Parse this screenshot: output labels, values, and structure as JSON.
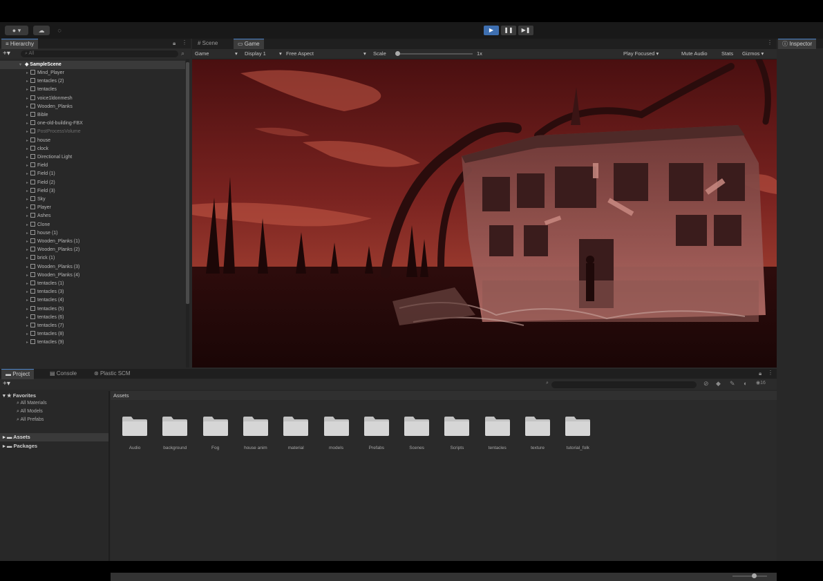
{
  "toolbar": {
    "account_label": "▾",
    "cloud_icon": "cloud-icon",
    "play_controls": [
      "▶",
      "❚❚",
      "▶❚"
    ]
  },
  "hierarchy": {
    "tab_label": "Hierarchy",
    "add_label": "+▾",
    "search_placeholder": "All",
    "root": "SampleScene",
    "items": [
      {
        "label": "Mind_Player",
        "disabled": false
      },
      {
        "label": "tentacles (2)",
        "disabled": false
      },
      {
        "label": "tentacles",
        "disabled": false
      },
      {
        "label": "voice1ldonmesh",
        "disabled": false
      },
      {
        "label": "Wooden_Planks",
        "disabled": false
      },
      {
        "label": "Bible",
        "disabled": false
      },
      {
        "label": "one-old-building-FBX",
        "disabled": false
      },
      {
        "label": "PostProcessVolume",
        "disabled": true
      },
      {
        "label": "house",
        "disabled": false
      },
      {
        "label": "clock",
        "disabled": false
      },
      {
        "label": "Directional Light",
        "disabled": false
      },
      {
        "label": "Field",
        "disabled": false
      },
      {
        "label": "Field (1)",
        "disabled": false
      },
      {
        "label": "Field (2)",
        "disabled": false
      },
      {
        "label": "Field (3)",
        "disabled": false
      },
      {
        "label": "Sky",
        "disabled": false
      },
      {
        "label": "Player",
        "disabled": false
      },
      {
        "label": "Ashes",
        "disabled": false
      },
      {
        "label": "Clone",
        "disabled": false
      },
      {
        "label": "house (1)",
        "disabled": false
      },
      {
        "label": "Wooden_Planks (1)",
        "disabled": false
      },
      {
        "label": "Wooden_Planks (2)",
        "disabled": false
      },
      {
        "label": "brick (1)",
        "disabled": false
      },
      {
        "label": "Wooden_Planks (3)",
        "disabled": false
      },
      {
        "label": "Wooden_Planks (4)",
        "disabled": false
      },
      {
        "label": "tentacles (1)",
        "disabled": false
      },
      {
        "label": "tentacles (3)",
        "disabled": false
      },
      {
        "label": "tentacles (4)",
        "disabled": false
      },
      {
        "label": "tentacles (5)",
        "disabled": false
      },
      {
        "label": "tentacles (6)",
        "disabled": false
      },
      {
        "label": "tentacles (7)",
        "disabled": false
      },
      {
        "label": "tentacles (8)",
        "disabled": false
      },
      {
        "label": "tentacles (9)",
        "disabled": false
      }
    ]
  },
  "view_tabs": {
    "scene": "Scene",
    "game": "Game"
  },
  "game_toolbar": {
    "mode": "Game",
    "display": "Display 1",
    "aspect": "Free Aspect",
    "scale_label": "Scale",
    "scale_value": "1x",
    "play_focused": "Play Focused",
    "mute_audio": "Mute Audio",
    "stats": "Stats",
    "gizmos": "Gizmos"
  },
  "project": {
    "tabs": [
      "Project",
      "Console",
      "Plastic SCM"
    ],
    "favorites_label": "Favorites",
    "favorites": [
      "All Materials",
      "All Models",
      "All Prefabs"
    ],
    "roots": [
      "Assets",
      "Packages"
    ],
    "breadcrumb": "Assets",
    "folders": [
      "Audio",
      "background",
      "Fog",
      "house anim",
      "material",
      "models",
      "Prefabs",
      "Scenes",
      "Scripts",
      "tentacles",
      "texture",
      "tutorial_folk"
    ],
    "item_count": "16"
  },
  "inspector": {
    "tab_label": "Inspector"
  },
  "colors": {
    "accent": "#3e6fb0",
    "panel": "#282828",
    "sky_red": "#8a2a24"
  }
}
